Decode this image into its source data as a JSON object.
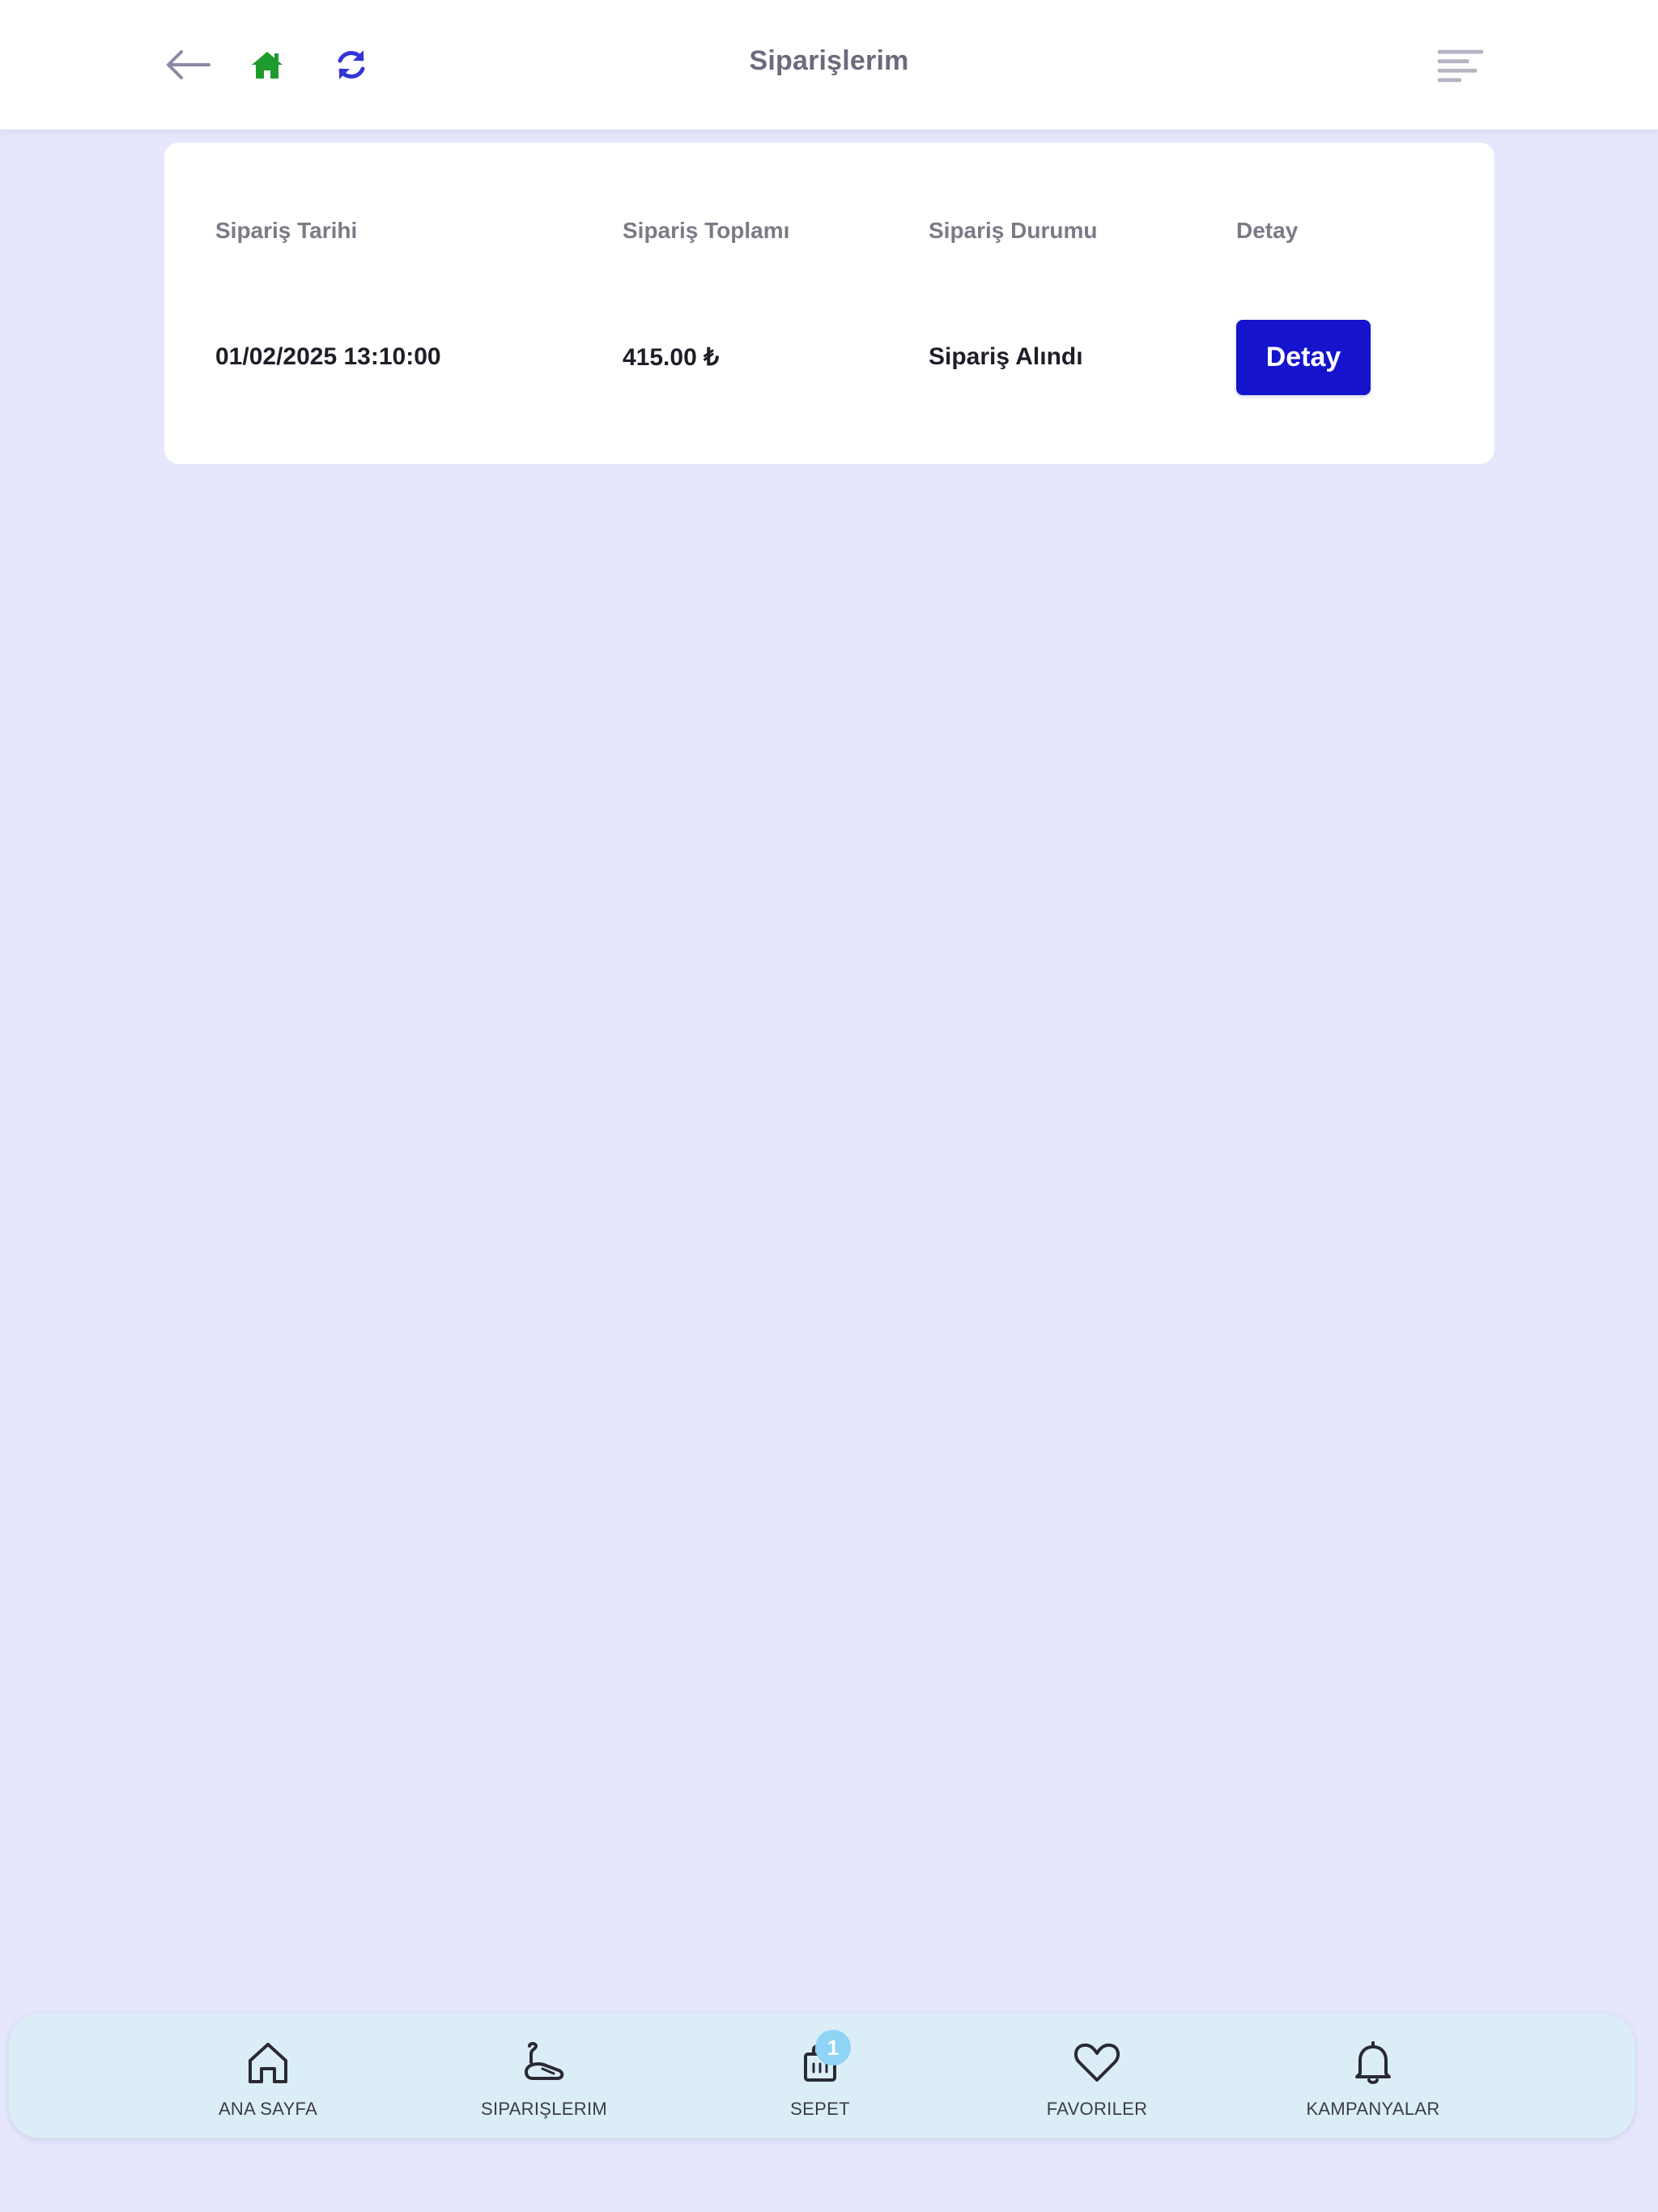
{
  "header": {
    "title": "Siparişlerim",
    "icons": {
      "back": "arrow-left-icon",
      "home": "home-icon",
      "refresh": "refresh-icon",
      "menu": "menu-lines-icon"
    }
  },
  "orders": {
    "columns": [
      "Sipariş Tarihi",
      "Sipariş Toplamı",
      "Sipariş Durumu",
      "Detay"
    ],
    "rows": [
      {
        "date": "01/02/2025 13:10:00",
        "total": "415.00 ₺",
        "status": "Sipariş Alındı",
        "action_label": "Detay"
      }
    ]
  },
  "bottom_nav": {
    "items": [
      {
        "label": "ANA SAYFA",
        "icon": "home-outline-icon"
      },
      {
        "label": "SIPARIŞLERIM",
        "icon": "orders-icon"
      },
      {
        "label": "SEPET",
        "icon": "cart-icon",
        "badge": "1"
      },
      {
        "label": "FAVORILER",
        "icon": "heart-icon"
      },
      {
        "label": "KAMPANYALAR",
        "icon": "bell-icon"
      }
    ]
  },
  "colors": {
    "background": "#e6e7fd",
    "accent": "#1514cc",
    "home_icon": "#1f9a2c",
    "refresh_icon": "#3434d8",
    "nav_background": "#dbeef7"
  }
}
